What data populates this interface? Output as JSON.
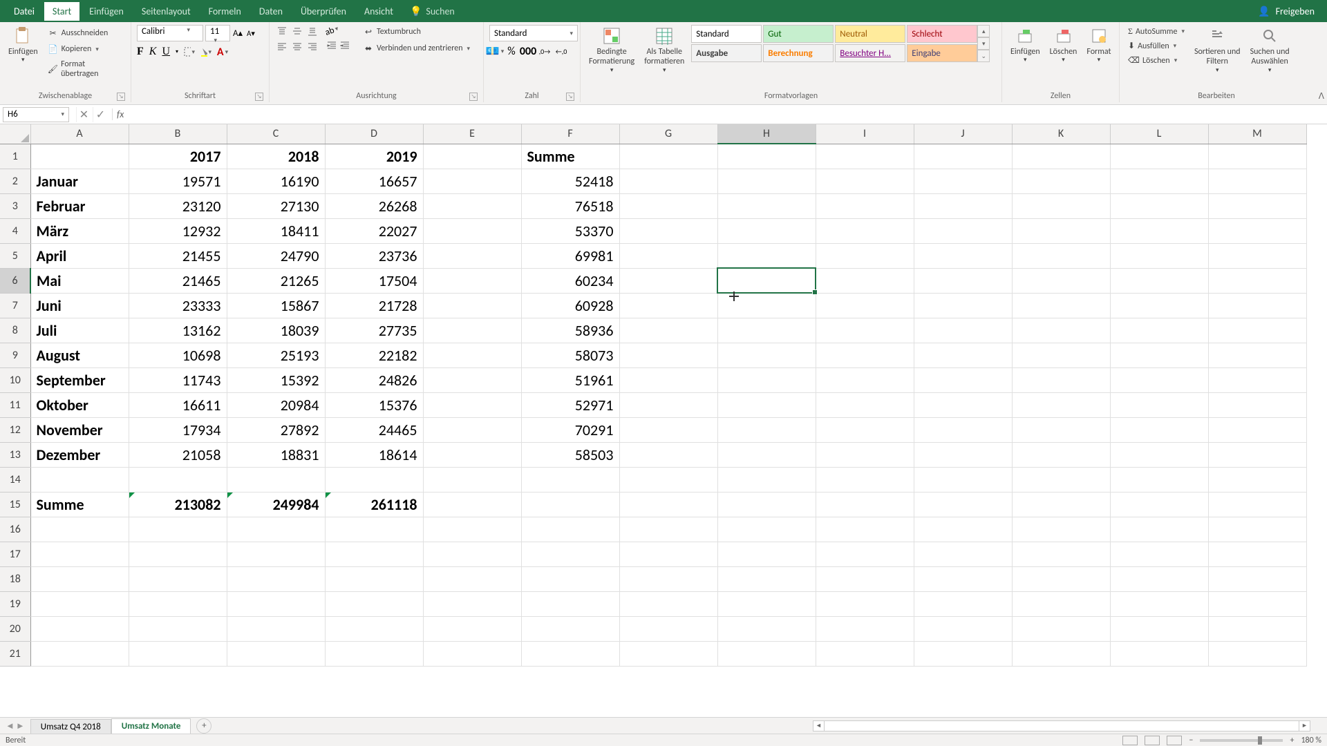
{
  "menu": {
    "file": "Datei",
    "tabs": [
      "Start",
      "Einfügen",
      "Seitenlayout",
      "Formeln",
      "Daten",
      "Überprüfen",
      "Ansicht"
    ],
    "active": "Start",
    "search": "Suchen",
    "share": "Freigeben"
  },
  "ribbon": {
    "clipboard": {
      "paste": "Einfügen",
      "cut": "Ausschneiden",
      "copy": "Kopieren",
      "format_painter": "Format übertragen",
      "label": "Zwischenablage"
    },
    "font": {
      "name": "Calibri",
      "size": "11",
      "label": "Schriftart"
    },
    "alignment": {
      "wrap": "Textumbruch",
      "merge": "Verbinden und zentrieren",
      "label": "Ausrichtung"
    },
    "number": {
      "format": "Standard",
      "label": "Zahl"
    },
    "styles": {
      "cond": "Bedingte\nFormatierung",
      "table": "Als Tabelle\nformatieren",
      "cells": [
        "Standard",
        "Gut",
        "Neutral",
        "Schlecht",
        "Ausgabe",
        "Berechnung",
        "Besuchter H...",
        "Eingabe"
      ],
      "label": "Formatvorlagen"
    },
    "cells_grp": {
      "insert": "Einfügen",
      "delete": "Löschen",
      "format": "Format",
      "label": "Zellen"
    },
    "editing": {
      "autosum": "AutoSumme",
      "fill": "Ausfüllen",
      "clear": "Löschen",
      "sort": "Sortieren und\nFiltern",
      "find": "Suchen und\nAuswählen",
      "label": "Bearbeiten"
    }
  },
  "name_box": "H6",
  "columns": [
    "A",
    "B",
    "C",
    "D",
    "E",
    "F",
    "G",
    "H",
    "I",
    "J",
    "K",
    "L",
    "M"
  ],
  "selected_col": "H",
  "selected_row": 6,
  "spreadsheet": {
    "header_row": {
      "A": "",
      "B": "2017",
      "C": "2018",
      "D": "2019",
      "E": "",
      "F": "Summe"
    },
    "rows": [
      {
        "A": "Januar",
        "B": 19571,
        "C": 16190,
        "D": 16657,
        "F": 52418
      },
      {
        "A": "Februar",
        "B": 23120,
        "C": 27130,
        "D": 26268,
        "F": 76518
      },
      {
        "A": "März",
        "B": 12932,
        "C": 18411,
        "D": 22027,
        "F": 53370
      },
      {
        "A": "April",
        "B": 21455,
        "C": 24790,
        "D": 23736,
        "F": 69981
      },
      {
        "A": "Mai",
        "B": 21465,
        "C": 21265,
        "D": 17504,
        "F": 60234
      },
      {
        "A": "Juni",
        "B": 23333,
        "C": 15867,
        "D": 21728,
        "F": 60928
      },
      {
        "A": "Juli",
        "B": 13162,
        "C": 18039,
        "D": 27735,
        "F": 58936
      },
      {
        "A": "August",
        "B": 10698,
        "C": 25193,
        "D": 22182,
        "F": 58073
      },
      {
        "A": "September",
        "B": 11743,
        "C": 15392,
        "D": 24826,
        "F": 51961
      },
      {
        "A": "Oktober",
        "B": 16611,
        "C": 20984,
        "D": 15376,
        "F": 52971
      },
      {
        "A": "November",
        "B": 17934,
        "C": 27892,
        "D": 24465,
        "F": 70291
      },
      {
        "A": "Dezember",
        "B": 21058,
        "C": 18831,
        "D": 18614,
        "F": 58503
      }
    ],
    "sum_row": {
      "A": "Summe",
      "B": 213082,
      "C": 249984,
      "D": 261118
    }
  },
  "sheets": {
    "tabs": [
      "Umsatz Q4 2018",
      "Umsatz Monate"
    ],
    "active": "Umsatz Monate"
  },
  "status": {
    "ready": "Bereit",
    "zoom": "180 %"
  }
}
